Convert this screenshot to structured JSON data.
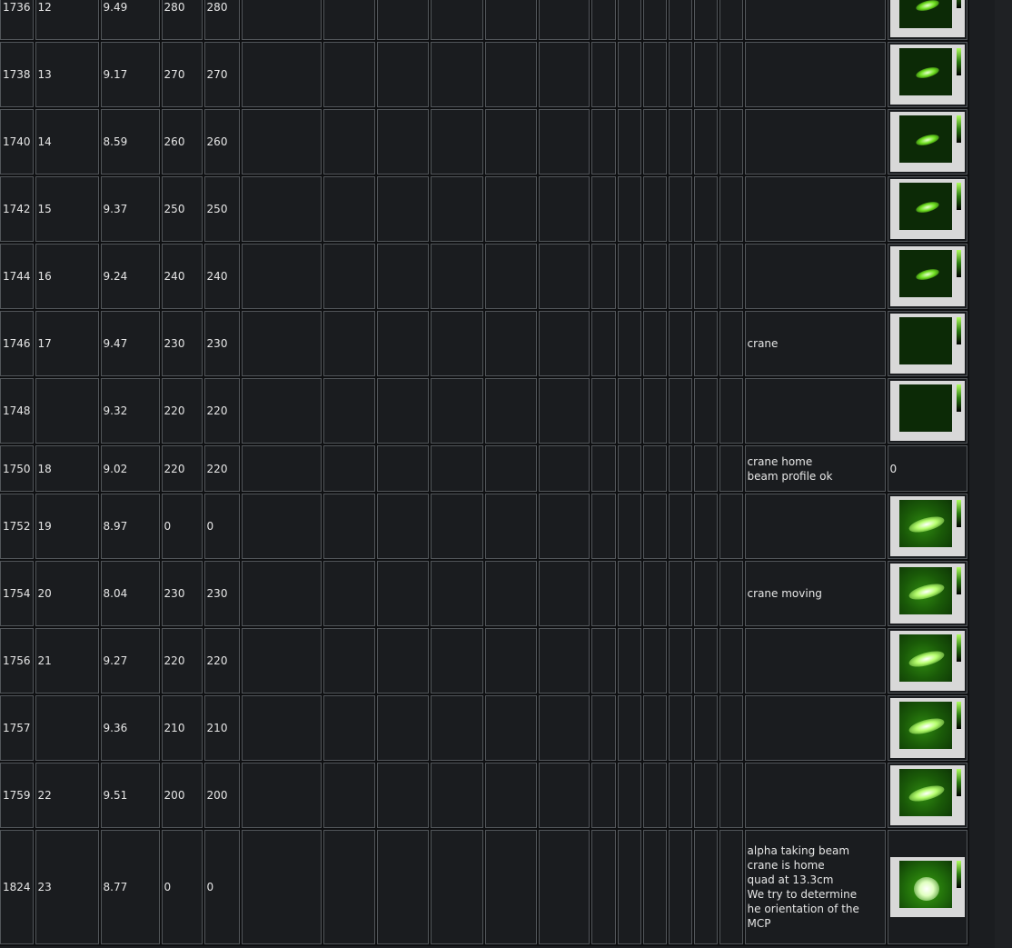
{
  "columns": 19,
  "rows": [
    {
      "run": "1736",
      "num": "12",
      "v": "9.49",
      "a": "280",
      "b": "280",
      "comment": "",
      "thumb": "normal"
    },
    {
      "run": "1738",
      "num": "13",
      "v": "9.17",
      "a": "270",
      "b": "270",
      "comment": "",
      "thumb": "normal"
    },
    {
      "run": "1740",
      "num": "14",
      "v": "8.59",
      "a": "260",
      "b": "260",
      "comment": "",
      "thumb": "normal"
    },
    {
      "run": "1742",
      "num": "15",
      "v": "9.37",
      "a": "250",
      "b": "250",
      "comment": "",
      "thumb": "normal"
    },
    {
      "run": "1744",
      "num": "16",
      "v": "9.24",
      "a": "240",
      "b": "240",
      "comment": "",
      "thumb": "normal"
    },
    {
      "run": "1746",
      "num": "17",
      "v": "9.47",
      "a": "230",
      "b": "230",
      "comment": "crane",
      "thumb": "dim"
    },
    {
      "run": "1748",
      "num": "",
      "v": "9.32",
      "a": "220",
      "b": "220",
      "comment": "",
      "thumb": "dim"
    },
    {
      "run": "1750",
      "num": "18",
      "v": "9.02",
      "a": "220",
      "b": "220",
      "comment": "crane home\nbeam profile ok",
      "thumb": "none",
      "thumb_text": "0"
    },
    {
      "run": "1752",
      "num": "19",
      "v": "8.97",
      "a": "0",
      "b": "0",
      "comment": "",
      "thumb": "bright"
    },
    {
      "run": "1754",
      "num": "20",
      "v": "8.04",
      "a": "230",
      "b": "230",
      "comment": "crane moving",
      "thumb": "bright"
    },
    {
      "run": "1756",
      "num": "21",
      "v": "9.27",
      "a": "220",
      "b": "220",
      "comment": "",
      "thumb": "bright"
    },
    {
      "run": "1757",
      "num": "",
      "v": "9.36",
      "a": "210",
      "b": "210",
      "comment": "",
      "thumb": "bright"
    },
    {
      "run": "1759",
      "num": "22",
      "v": "9.51",
      "a": "200",
      "b": "200",
      "comment": "",
      "thumb": "bright"
    },
    {
      "run": "1824",
      "num": "23",
      "v": "8.77",
      "a": "0",
      "b": "0",
      "comment": "alpha taking beam\ncrane is home\nquad at 13.3cm\nWe try to determine\nhe orientation of the\nMCP",
      "thumb": "big"
    }
  ]
}
